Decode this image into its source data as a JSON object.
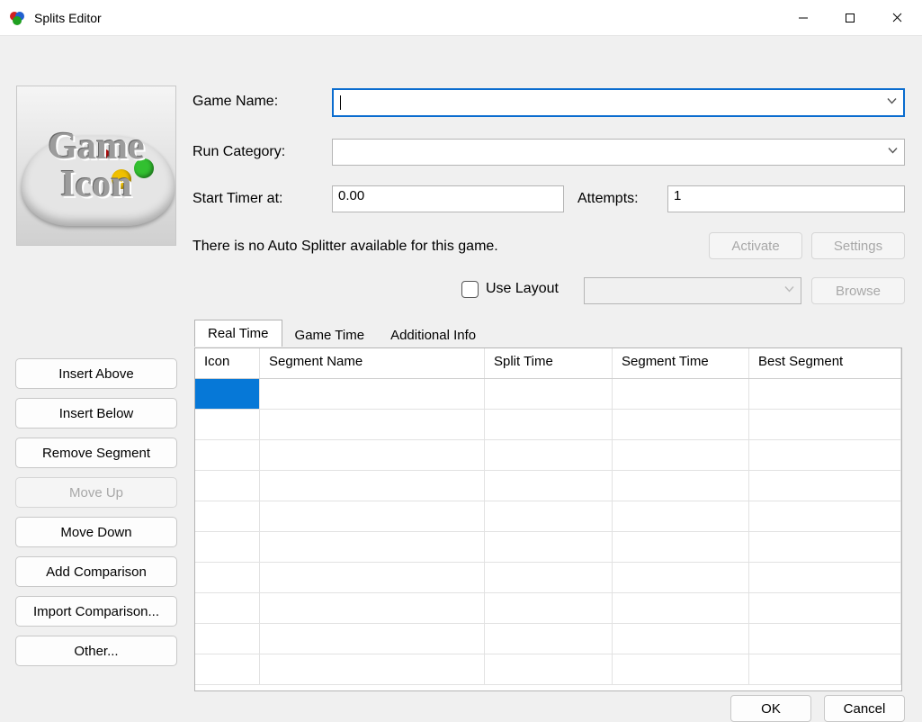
{
  "window": {
    "title": "Splits Editor"
  },
  "icon_label_line1": "Game",
  "icon_label_line2": "Icon",
  "labels": {
    "game_name": "Game Name:",
    "run_category": "Run Category:",
    "start_timer_at": "Start Timer at:",
    "attempts": "Attempts:",
    "autosplitter_msg": "There is no Auto Splitter available for this game.",
    "use_layout": "Use Layout"
  },
  "fields": {
    "game_name": "",
    "run_category": "",
    "start_timer_at": "0.00",
    "attempts": "1",
    "layout_path": ""
  },
  "buttons": {
    "activate": "Activate",
    "settings": "Settings",
    "browse": "Browse",
    "insert_above": "Insert Above",
    "insert_below": "Insert Below",
    "remove_segment": "Remove Segment",
    "move_up": "Move Up",
    "move_down": "Move Down",
    "add_comparison": "Add Comparison",
    "import_comparison": "Import Comparison...",
    "other": "Other...",
    "ok": "OK",
    "cancel": "Cancel"
  },
  "tabs": {
    "real_time": "Real Time",
    "game_time": "Game Time",
    "additional_info": "Additional Info",
    "active": "real_time"
  },
  "grid": {
    "headers": {
      "icon": "Icon",
      "segment_name": "Segment Name",
      "split_time": "Split Time",
      "segment_time": "Segment Time",
      "best_segment": "Best Segment"
    },
    "rows": [
      {
        "icon": "",
        "segment_name": "",
        "split_time": "",
        "segment_time": "",
        "best_segment": "",
        "selected": true
      }
    ],
    "visible_row_count": 10
  }
}
